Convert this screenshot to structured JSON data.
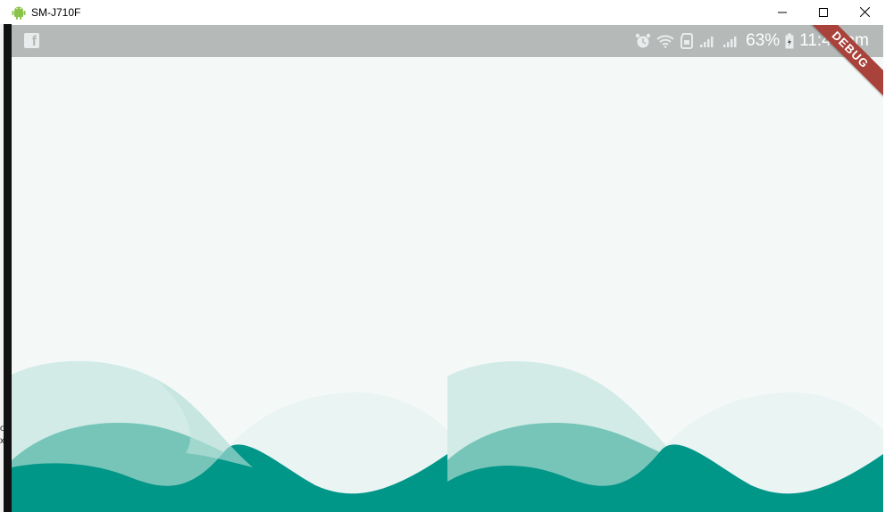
{
  "window": {
    "title": "SM-J710F",
    "icon": "android-icon",
    "controls": [
      "minimize-icon",
      "maximize-icon",
      "close-icon"
    ]
  },
  "left_edge": {
    "text": "o x"
  },
  "statusbar": {
    "left_icons": [
      "facebook-icon"
    ],
    "battery_percent": "63%",
    "time": "11:48 am",
    "right_icons": [
      "alarm-icon",
      "wifi-icon",
      "sim-icon",
      "signal-icon",
      "signal-icon",
      "battery-icon"
    ]
  },
  "app": {
    "debug_banner": "DEBUG",
    "background_color": "#f4f9f8",
    "wave_colors": [
      "#d2ebe7",
      "#77c5b9",
      "#009688"
    ]
  }
}
